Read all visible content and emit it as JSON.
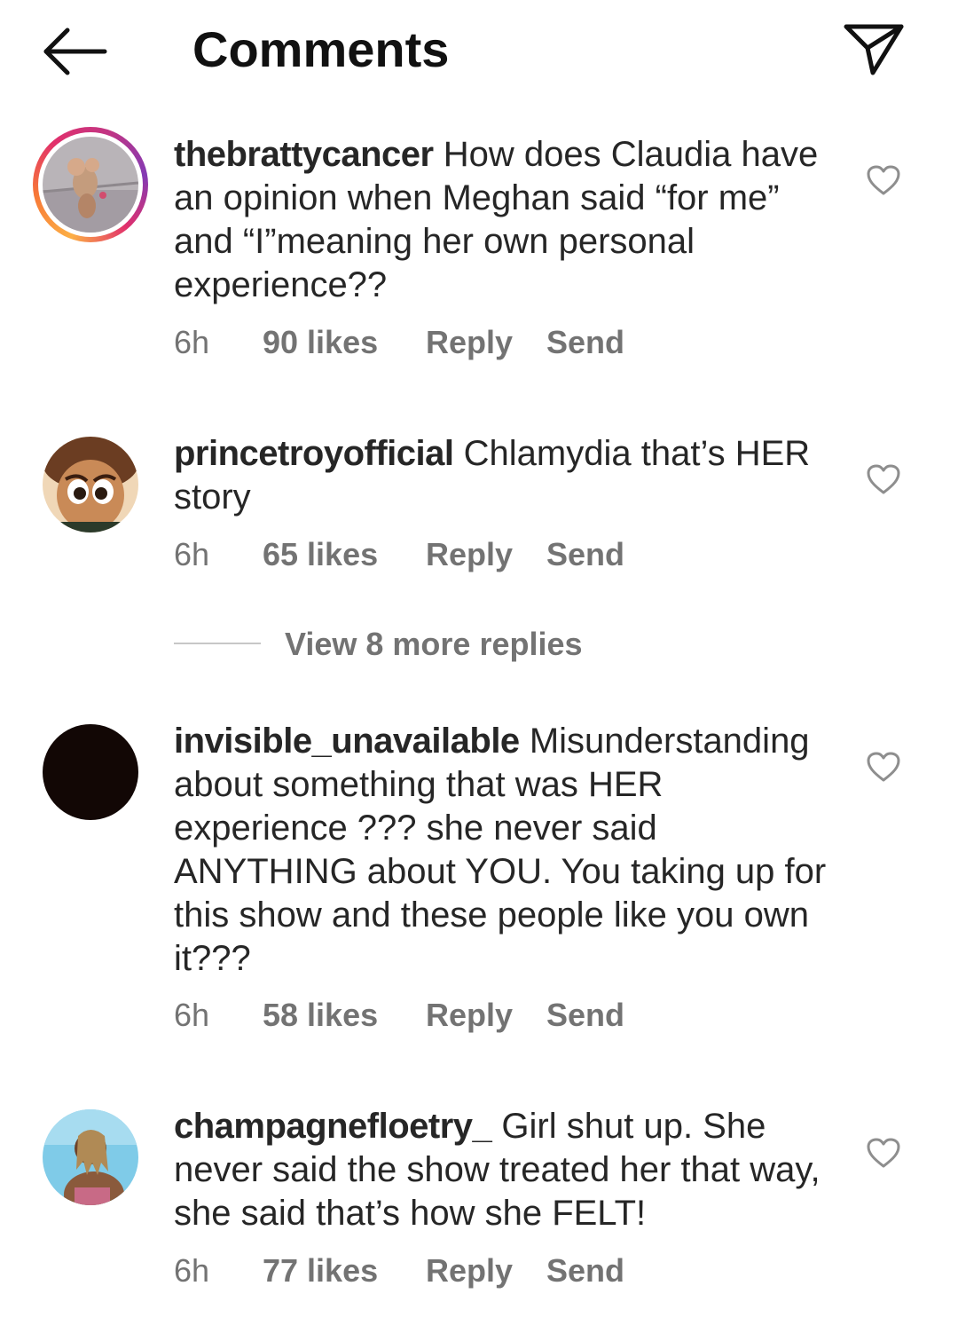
{
  "header": {
    "title": "Comments",
    "back_icon": "arrow-left-icon",
    "share_icon": "paper-plane-icon"
  },
  "comments": [
    {
      "username": "thebrattycancer",
      "text": "How does Claudia have an opinion when Meghan said “for me”  and “I”meaning her own personal experience??",
      "time": "6h",
      "likes": "90 likes",
      "reply": "Reply",
      "send": "Send",
      "has_story_ring": true
    },
    {
      "username": "princetroyofficial",
      "text": "Chlamydia that’s HER story",
      "time": "6h",
      "likes": "65 likes",
      "reply": "Reply",
      "send": "Send",
      "has_story_ring": false
    },
    {
      "username": "invisible_unavailable",
      "text": "Misunderstanding about something that was HER experience ??? she never said ANYTHING about YOU. You taking up for this show and these people like you own it???",
      "time": "6h",
      "likes": "58 likes",
      "reply": "Reply",
      "send": "Send",
      "has_story_ring": false
    },
    {
      "username": "champagnefloetry_",
      "text": "Girl shut up. She never said the show treated her that way, she said that’s how she FELT!",
      "time": "6h",
      "likes": "77 likes",
      "reply": "Reply",
      "send": "Send",
      "has_story_ring": false
    }
  ],
  "view_more_replies": "View 8 more replies",
  "colors": {
    "text": "#262626",
    "meta": "#737373",
    "story_ring": "#e1306c"
  }
}
